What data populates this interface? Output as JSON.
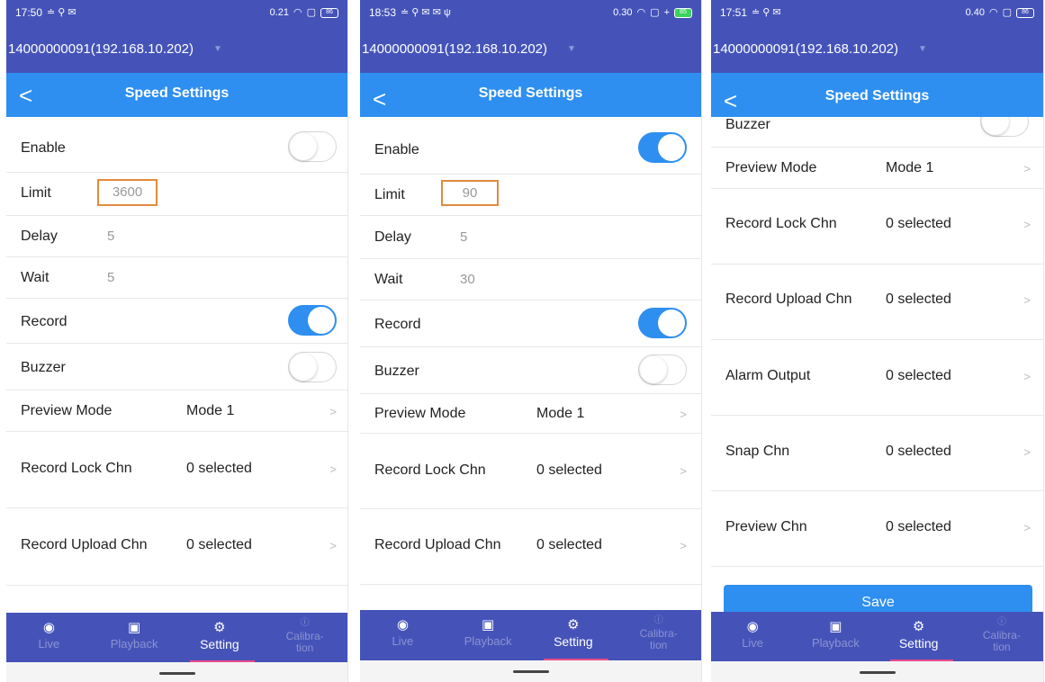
{
  "device": "14000000091(192.168.10.202)",
  "page_title": "Speed Settings",
  "tabs": {
    "live": "Live",
    "playback": "Playback",
    "setting": "Setting",
    "calibration_1": "Calibra-",
    "calibration_2": "tion"
  },
  "labels": {
    "enable": "Enable",
    "limit": "Limit",
    "delay": "Delay",
    "wait": "Wait",
    "record": "Record",
    "buzzer": "Buzzer",
    "preview_mode": "Preview Mode",
    "record_lock_chn": "Record Lock Chn",
    "record_upload_chn": "Record Upload Chn",
    "alarm_output": "Alarm Output",
    "snap_chn": "Snap Chn",
    "preview_chn": "Preview Chn",
    "save": "Save"
  },
  "screens": [
    {
      "time": "17:50",
      "status_extra": "≐ ⚲ ✉",
      "net_rate": "0.21",
      "battery": "86",
      "enable_on": false,
      "record_on": true,
      "buzzer_on": false,
      "limit": "3600",
      "delay": "5",
      "wait": "5",
      "preview_mode": "Mode 1",
      "record_lock_chn": "0 selected",
      "record_upload_chn": "0 selected"
    },
    {
      "time": "18:53",
      "status_extra": "≐ ⚲ ✉ ✉ ψ",
      "net_rate": "0.30",
      "battery": "85",
      "enable_on": true,
      "record_on": true,
      "buzzer_on": false,
      "limit": "90",
      "delay": "5",
      "wait": "30",
      "preview_mode": "Mode 1",
      "record_lock_chn": "0 selected",
      "record_upload_chn": "0 selected"
    },
    {
      "time": "17:51",
      "status_extra": "≐ ⚲ ✉",
      "net_rate": "0.40",
      "battery": "86",
      "buzzer_on": false,
      "preview_mode": "Mode 1",
      "record_lock_chn": "0 selected",
      "record_upload_chn": "0 selected",
      "alarm_output": "0 selected",
      "snap_chn": "0 selected",
      "preview_chn": "0 selected"
    }
  ],
  "colors": {
    "header": "#4553b9",
    "titlebar": "#2e8ff0",
    "accent": "#2e8ff0",
    "highlight_box": "#e28a3c",
    "active_tab_underline": "#e94a8a"
  }
}
